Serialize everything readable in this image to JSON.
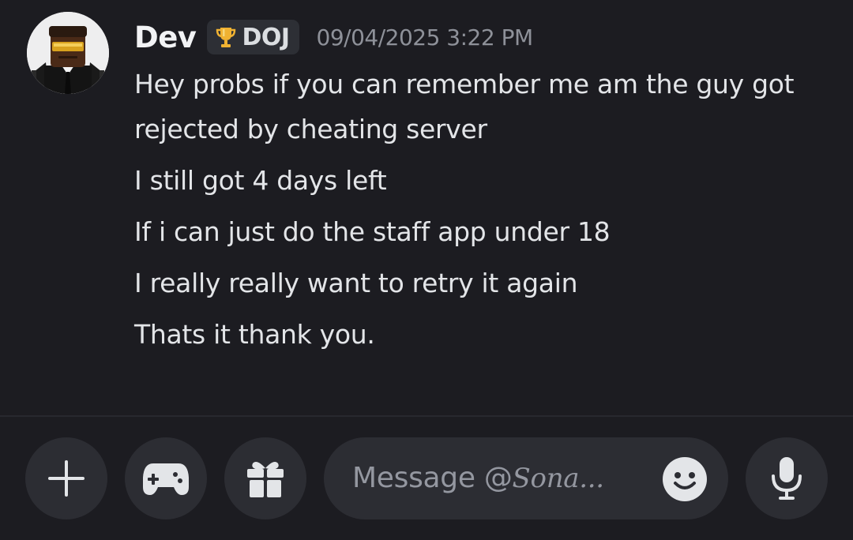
{
  "message": {
    "author": "Dev",
    "role_tag": {
      "icon": "trophy-icon",
      "label": "DOJ"
    },
    "timestamp": "09/04/2025 3:22 PM",
    "avatar": "avatar-roblox-suit-gold-visor",
    "lines": [
      "Hey probs if you can remember me am the guy got",
      "rejected by cheating server",
      "I still got 4 days left",
      "If i can just do the staff app under 18",
      "I really really want to retry it again",
      "Thats it thank you."
    ]
  },
  "composer": {
    "placeholder_prefix": "Message @",
    "placeholder_recipient": "Sona...",
    "buttons": [
      "plus-icon",
      "gamepad-icon",
      "gift-icon",
      "emoji-icon",
      "microphone-icon"
    ]
  },
  "colors": {
    "background": "#1c1c21",
    "surface": "#2c2d33",
    "text": "#e3e5e8",
    "muted": "#8e9199",
    "trophy": "#f0b232"
  }
}
